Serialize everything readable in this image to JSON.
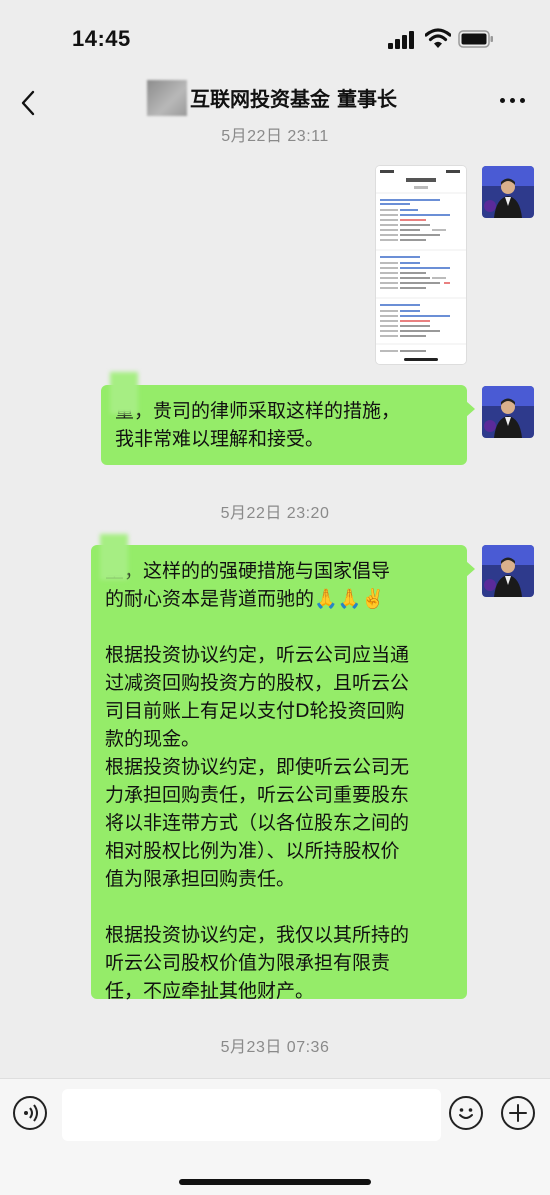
{
  "status_bar": {
    "time": "14:45"
  },
  "header": {
    "title": "互联网投资基金 董事长"
  },
  "messages": [
    {
      "timestamp": "5月22日 23:11"
    },
    {
      "text": "董，贵司的律师采取这样的措施，\n我非常难以理解和接受。"
    },
    {
      "timestamp": "5月22日 23:20"
    },
    {
      "text": "董，这样的的强硬措施与国家倡导\n的耐心资本是背道而驰的🙏🙏✌️\n\n根据投资协议约定，听云公司应当通\n过减资回购投资方的股权，且听云公\n司目前账上有足以支付D轮投资回购\n款的现金。\n根据投资协议约定，即使听云公司无\n力承担回购责任，听云公司重要股东\n将以非连带方式（以各位股东之间的\n相对股权比例为准）、以所持股权价\n值为限承担回购责任。\n\n根据投资协议约定，我仅以其所持的\n听云公司股权价值为限承担有限责\n任，不应牵扯其他财产。"
    },
    {
      "timestamp": "5月23日 07:36"
    }
  ],
  "input_bar": {
    "placeholder": ""
  }
}
